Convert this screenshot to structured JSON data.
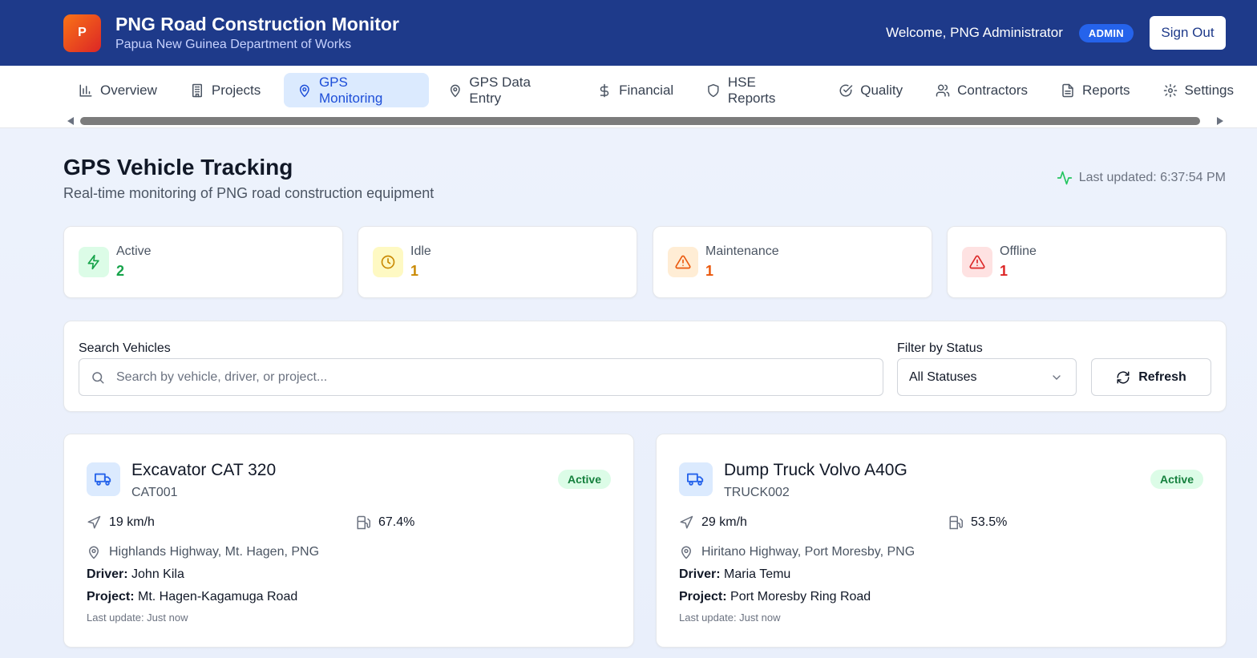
{
  "header": {
    "logo_letter": "P",
    "title": "PNG Road Construction Monitor",
    "subtitle": "Papua New Guinea Department of Works",
    "welcome": "Welcome, PNG Administrator",
    "role_badge": "ADMIN",
    "sign_out": "Sign Out",
    "bg_color": "#1e3a8a"
  },
  "nav": {
    "tabs": [
      {
        "label": "Overview",
        "icon": "bar-chart-icon"
      },
      {
        "label": "Projects",
        "icon": "building-icon"
      },
      {
        "label": "GPS Monitoring",
        "icon": "map-pin-icon",
        "active": true
      },
      {
        "label": "GPS Data Entry",
        "icon": "map-pin-icon"
      },
      {
        "label": "Financial",
        "icon": "dollar-icon"
      },
      {
        "label": "HSE Reports",
        "icon": "shield-icon"
      },
      {
        "label": "Quality",
        "icon": "check-circle-icon"
      },
      {
        "label": "Contractors",
        "icon": "users-icon"
      },
      {
        "label": "Reports",
        "icon": "file-text-icon"
      },
      {
        "label": "Settings",
        "icon": "gear-icon"
      }
    ]
  },
  "page": {
    "title": "GPS Vehicle Tracking",
    "subtitle": "Real-time monitoring of PNG road construction equipment",
    "last_updated": "Last updated: 6:37:54 PM"
  },
  "stats": [
    {
      "label": "Active",
      "value": "2",
      "color": "#16a34a",
      "bg": "#dcfce7",
      "icon": "zap-icon"
    },
    {
      "label": "Idle",
      "value": "1",
      "color": "#ca8a04",
      "bg": "#fef9c3",
      "icon": "clock-icon"
    },
    {
      "label": "Maintenance",
      "value": "1",
      "color": "#ea580c",
      "bg": "#ffedd5",
      "icon": "warning-icon"
    },
    {
      "label": "Offline",
      "value": "1",
      "color": "#dc2626",
      "bg": "#fee2e2",
      "icon": "alert-icon"
    }
  ],
  "search": {
    "label": "Search Vehicles",
    "placeholder": "Search by vehicle, driver, or project...",
    "filter_label": "Filter by Status",
    "filter_value": "All Statuses",
    "refresh": "Refresh"
  },
  "vehicles": [
    {
      "name": "Excavator CAT 320",
      "id": "CAT001",
      "status": "Active",
      "speed": "19 km/h",
      "fuel": "67.4%",
      "location": "Highlands Highway, Mt. Hagen, PNG",
      "driver_label": "Driver:",
      "driver": "John Kila",
      "project_label": "Project:",
      "project": "Mt. Hagen-Kagamuga Road",
      "last_update": "Last update: Just now"
    },
    {
      "name": "Dump Truck Volvo A40G",
      "id": "TRUCK002",
      "status": "Active",
      "speed": "29 km/h",
      "fuel": "53.5%",
      "location": "Hiritano Highway, Port Moresby, PNG",
      "driver_label": "Driver:",
      "driver": "Maria Temu",
      "project_label": "Project:",
      "project": "Port Moresby Ring Road",
      "last_update": "Last update: Just now"
    }
  ]
}
